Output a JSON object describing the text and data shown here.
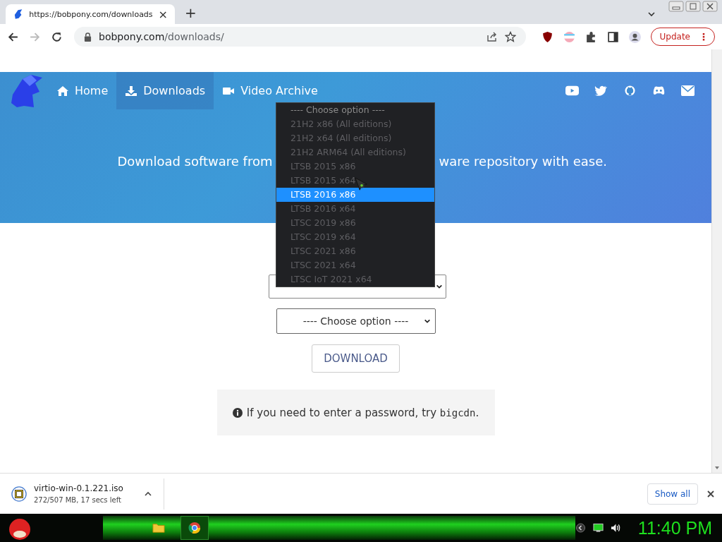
{
  "browser": {
    "tabs": [
      {
        "title": "https://bobpony.com/downloads",
        "selected": true
      }
    ],
    "tab_close": "×",
    "new_tab": "+",
    "address": {
      "host": "bobpony.com",
      "path": "/downloads/"
    },
    "update_button": "Update",
    "menu": "⋮"
  },
  "nav": {
    "items": [
      {
        "label": "Home",
        "selected": false
      },
      {
        "label": "Downloads",
        "selected": true
      },
      {
        "label": "Video Archive",
        "selected": false
      }
    ]
  },
  "hero": {
    "text_left": "Download software from",
    "text_right": "ware repository with ease."
  },
  "dropdown": {
    "options": [
      {
        "label": "---- Choose option ----",
        "disabled": false,
        "selected": false
      },
      {
        "label": "21H2 x86 (All editions)",
        "disabled": true,
        "selected": false
      },
      {
        "label": "21H2 x64 (All editions)",
        "disabled": true,
        "selected": false
      },
      {
        "label": "21H2 ARM64 (All editions)",
        "disabled": true,
        "selected": false
      },
      {
        "label": "LTSB 2015 x86",
        "disabled": true,
        "selected": false
      },
      {
        "label": "LTSB 2015 x64",
        "disabled": true,
        "selected": false
      },
      {
        "label": "LTSB 2016 x86",
        "disabled": true,
        "selected": true
      },
      {
        "label": "LTSB 2016 x64",
        "disabled": true,
        "selected": false
      },
      {
        "label": "LTSC 2019 x86",
        "disabled": true,
        "selected": false
      },
      {
        "label": "LTSC 2019 x64",
        "disabled": true,
        "selected": false
      },
      {
        "label": "LTSC 2021 x86",
        "disabled": true,
        "selected": false
      },
      {
        "label": "LTSC 2021 x64",
        "disabled": true,
        "selected": false
      },
      {
        "label": "LTSC IoT 2021 x64",
        "disabled": true,
        "selected": false
      }
    ]
  },
  "select_2": {
    "value": "---- Choose option ----"
  },
  "download_button": "DOWNLOAD",
  "notice": {
    "text": "If you need to enter a password, try ",
    "code": "bigcdn",
    "end": "."
  },
  "download_shelf": {
    "file": "virtio-win-0.1.221.iso",
    "status": "272/507 MB, 17 secs left",
    "show_all": "Show all"
  },
  "taskbar": {
    "clock": "11:40 PM"
  }
}
